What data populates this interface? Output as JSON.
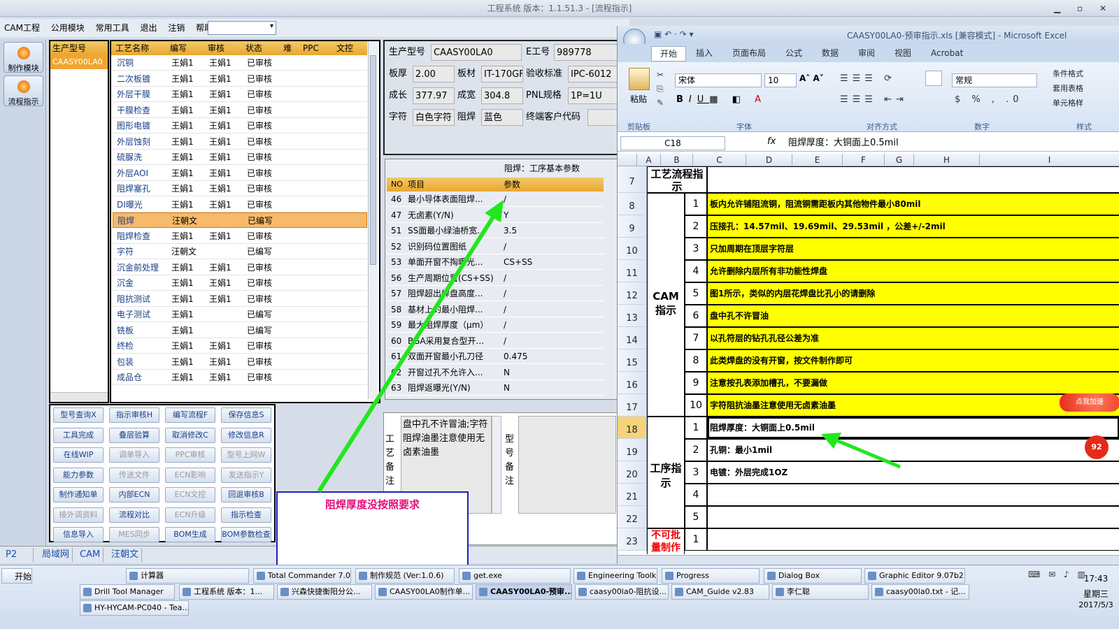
{
  "window": {
    "title": "工程系统   版本：1.1.51.3 - [流程指示]"
  },
  "menu": [
    "CAM工程",
    "公用模块",
    "常用工具",
    "退出",
    "注销",
    "帮助"
  ],
  "left_buttons": [
    "制作模块",
    "流程指示"
  ],
  "model_panel": {
    "header": "生产型号",
    "items": [
      "CAASY00LA0"
    ]
  },
  "process_table": {
    "columns": [
      "工艺名称",
      "编写",
      "审核",
      "状态",
      "难",
      "PPC",
      "文控"
    ],
    "rows": [
      [
        "沉铜",
        "王娟1",
        "王娟1",
        "已审核"
      ],
      [
        "二次板镀",
        "王娟1",
        "王娟1",
        "已审核"
      ],
      [
        "外层干膜",
        "王娟1",
        "王娟1",
        "已审核"
      ],
      [
        "干膜检查",
        "王娟1",
        "王娟1",
        "已审核"
      ],
      [
        "图形电镀",
        "王娟1",
        "王娟1",
        "已审核"
      ],
      [
        "外层蚀刻",
        "王娟1",
        "王娟1",
        "已审核"
      ],
      [
        "硫脲洗",
        "王娟1",
        "王娟1",
        "已审核"
      ],
      [
        "外层AOI",
        "王娟1",
        "王娟1",
        "已审核"
      ],
      [
        "阻焊塞孔",
        "王娟1",
        "王娟1",
        "已审核"
      ],
      [
        "DI曝光",
        "王娟1",
        "王娟1",
        "已审核"
      ],
      [
        "阻焊",
        "汪朝文",
        "",
        "已编写"
      ],
      [
        "阻焊检查",
        "王娟1",
        "王娟1",
        "已审核"
      ],
      [
        "字符",
        "汪朝文",
        "",
        "已编写"
      ],
      [
        "沉金前处理",
        "王娟1",
        "王娟1",
        "已审核"
      ],
      [
        "沉金",
        "王娟1",
        "王娟1",
        "已审核"
      ],
      [
        "阻抗测试",
        "王娟1",
        "王娟1",
        "已审核"
      ],
      [
        "电子测试",
        "王娟1",
        "",
        "已编写"
      ],
      [
        "铣板",
        "王娟1",
        "",
        "已编写"
      ],
      [
        "终检",
        "王娟1",
        "王娟1",
        "已审核"
      ],
      [
        "包装",
        "王娟1",
        "王娟1",
        "已审核"
      ],
      [
        "成品仓",
        "王娟1",
        "王娟1",
        "已审核"
      ]
    ],
    "selected_index": 10
  },
  "buttons": [
    [
      "型号查询X",
      "指示审核H",
      "编写流程F",
      "保存信息S"
    ],
    [
      "工具完成",
      "叠层验算",
      "取消修改C",
      "修改信息R"
    ],
    [
      "在线WIP",
      "调单导入",
      "PPC审核",
      "型号上网W"
    ],
    [
      "能力参数",
      "传送文件",
      "ECN影响",
      "发送指示Y"
    ],
    [
      "制作通知单",
      "内部ECN",
      "ECN文控",
      "回退审核B"
    ],
    [
      "接外调资料",
      "流程对比",
      "ECN升级",
      "指示检查"
    ],
    [
      "信息导入",
      "MES同步",
      "BOM生成",
      "BOM参数检查"
    ]
  ],
  "disabled_buttons": [
    "调单导入",
    "PPC审核",
    "型号上网W",
    "传送文件",
    "ECN影响",
    "发送指示Y",
    "ECN文控",
    "接外调资料",
    "ECN升级",
    "MES同步"
  ],
  "info": {
    "model_label": "生产型号",
    "model_value": "CAASY00LA0",
    "eno_label": "E工号",
    "eno_value": "989778",
    "thick_label": "板厚",
    "thick_value": "2.00",
    "material_label": "板材",
    "material_value": "IT-170GF",
    "std_label": "验收标准",
    "std_value": "IPC-6012",
    "len_label": "成长",
    "len_value": "377.97",
    "wid_label": "成宽",
    "wid_value": "304.8",
    "pnl_label": "PNL规格",
    "pnl_value": "1P=1U",
    "char_label": "字符",
    "char_value": "白色字符",
    "mask_label": "阻焊",
    "mask_value": "蓝色",
    "cust_label": "终端客户代码",
    "cust_value": ""
  },
  "params": {
    "title": "阻焊：工序基本参数",
    "columns": [
      "NO",
      "项目",
      "参数"
    ],
    "rows": [
      [
        "46",
        "最小导体表面阻焊...",
        "/"
      ],
      [
        "47",
        "无卤素(Y/N)",
        "Y"
      ],
      [
        "51",
        "SS面最小绿油桥宽...",
        "3.5"
      ],
      [
        "52",
        "识别码位置图纸",
        "/"
      ],
      [
        "53",
        "单面开窗不掏曝光...",
        "CS+SS"
      ],
      [
        "56",
        "生产周期位置(CS+SS)",
        "/"
      ],
      [
        "57",
        "阻焊超出焊盘高度...",
        "/"
      ],
      [
        "58",
        "基材上的最小阻焊...",
        "/"
      ],
      [
        "59",
        "最大阻焊厚度（μm）",
        "/"
      ],
      [
        "60",
        "BGA采用复合型开...",
        "/"
      ],
      [
        "61",
        "双面开窗最小孔刀径",
        "0.475"
      ],
      [
        "62",
        "开窗过孔不允许入...",
        "N"
      ],
      [
        "63",
        "阻焊返曝光(Y/N)",
        "N"
      ]
    ]
  },
  "notes": {
    "process_label": "工艺备注",
    "process_text": "盘中孔不许冒油;字符阻焊油墨注意使用无卤素油墨",
    "model_label": "型号备注"
  },
  "bottom_tabs": [
    "P2",
    "局域网",
    "CAM",
    "汪朝文"
  ],
  "annotation": "阻焊厚度没按照要求",
  "excel": {
    "title": "CAASY00LA0-预审指示.xls [兼容模式] - Microsoft Excel",
    "tabs": [
      "开始",
      "插入",
      "页面布局",
      "公式",
      "数据",
      "审阅",
      "视图",
      "Acrobat"
    ],
    "font_name": "宋体",
    "font_size": "10",
    "number_format": "常规",
    "group_labels": [
      "剪贴板",
      "字体",
      "对齐方式",
      "数字",
      "样式"
    ],
    "paste_label": "粘贴",
    "style_items": [
      "条件格式",
      "套用表格",
      "单元格样"
    ],
    "name_box": "C18",
    "formula": "阻焊厚度：大铜面上0.5mil",
    "columns": [
      "A",
      "B",
      "C",
      "D",
      "E",
      "F",
      "G",
      "H",
      "I"
    ],
    "header_cell": "工艺流程指示",
    "cam_label": "CAM指示",
    "proc_label": "工序指示",
    "forbid_label": "不可批量制作",
    "row_numbers": [
      "7",
      "8",
      "9",
      "10",
      "11",
      "12",
      "13",
      "14",
      "15",
      "16",
      "17",
      "18",
      "19",
      "20",
      "21",
      "22",
      "23"
    ],
    "cam_rows": [
      [
        "1",
        "板内允许铺阻流铜，阻流铜需距板内其他物件最小80mil"
      ],
      [
        "2",
        "压接孔：14.57mil、19.69mil、29.53mil ，公差+/-2mil"
      ],
      [
        "3",
        "只加周期在顶层字符层"
      ],
      [
        "4",
        "允许删除内层所有非功能性焊盘"
      ],
      [
        "5",
        "图1所示，类似的内层花焊盘比孔小的请删除"
      ],
      [
        "6",
        "盘中孔不许冒油"
      ],
      [
        "7",
        "以孔符层的钻孔孔径公差为准"
      ],
      [
        "8",
        "此类焊盘的没有开窗，按文件制作即可"
      ],
      [
        "9",
        "注意按孔表添加槽孔，不要漏做"
      ],
      [
        "10",
        "字符阻抗油墨注意使用无卤素油墨"
      ]
    ],
    "proc_rows": [
      [
        "1",
        "阻焊厚度：大铜面上0.5mil"
      ],
      [
        "2",
        "孔铜：最小1mil"
      ],
      [
        "3",
        "电镀：外层完成1OZ"
      ],
      [
        "4",
        ""
      ],
      [
        "5",
        ""
      ]
    ],
    "forbid_rows": [
      [
        "1",
        ""
      ]
    ],
    "float_badge": "点我加速",
    "float_num": "92"
  },
  "taskbar": {
    "start": "开始",
    "row1": [
      "计算器",
      "Total Commander 7.0 ...",
      "制作规范 (Ver:1.0.6)",
      "get.exe",
      "Engineering Toolkit 9....",
      "Progress",
      "Dialog Box",
      "Graphic Editor 9.07b2 ..."
    ],
    "row2": [
      "Drill Tool Manager",
      "工程系统  版本：1...",
      "兴森快捷衡阳分公...",
      "CAASY00LA0制作单...",
      "CAASY00LA0-预审...",
      "caasy00la0-阻抗设...",
      "CAM_Guide v2.83",
      "李仁聪",
      "caasy00la0.txt - 记..."
    ],
    "row3": [
      "HY-HYCAM-PC040 - Tea..."
    ],
    "clock_time": "17:43",
    "clock_day": "星期三",
    "clock_date": "2017/5/3"
  },
  "colors": {
    "selection": "#f7b96a",
    "highlight": "#ffff00",
    "arrow": "#22e61e",
    "annot_text": "#e0107a"
  }
}
